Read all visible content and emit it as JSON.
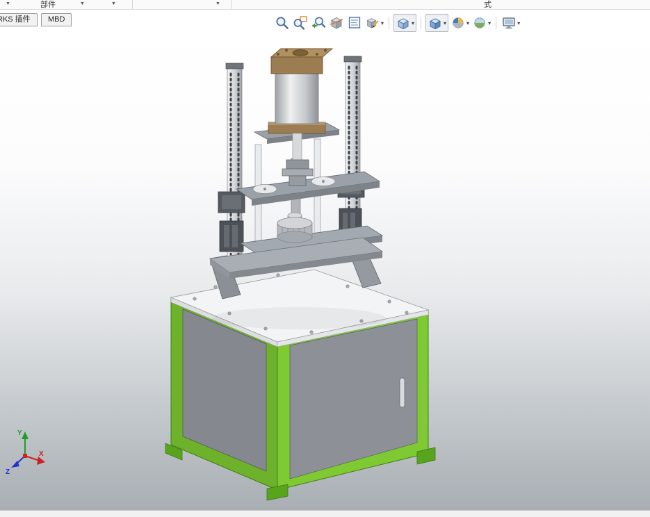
{
  "top_toolbar": {
    "label_left": "部件",
    "label_right": "式",
    "caret_glyph": "▼"
  },
  "tab_bar": {
    "tabs": [
      {
        "label": "RKS 插件"
      },
      {
        "label": "MBD"
      }
    ]
  },
  "headsup_toolbar": {
    "caret_glyph": "▾",
    "icons": [
      {
        "name": "zoom-to-fit",
        "dropdown": false
      },
      {
        "name": "zoom-to-area",
        "dropdown": false
      },
      {
        "name": "previous-view",
        "dropdown": false
      },
      {
        "name": "section-view",
        "dropdown": false
      },
      {
        "name": "annotation-3d-view",
        "dropdown": false
      },
      {
        "name": "dynamic-annotation",
        "dropdown": true
      },
      {
        "name": "view-orientation",
        "dropdown": true
      },
      {
        "name": "display-style",
        "dropdown": true
      },
      {
        "name": "edit-appearance",
        "dropdown": true
      },
      {
        "name": "apply-scene",
        "dropdown": true
      },
      {
        "name": "view-settings",
        "dropdown": true
      }
    ]
  },
  "viewport": {
    "triad": {
      "x_label": "X",
      "y_label": "Y",
      "z_label": "Z"
    }
  },
  "colors": {
    "frame-green": "#6db22a",
    "frame-green-light": "#7fca33",
    "frame-green-dark": "#58a51d",
    "panel-gray": "#8d9197",
    "panel-gray-dark": "#85898f",
    "table-white": "#f3f4f6",
    "axis-x": "#cc2222",
    "axis-y": "#1f9d2c",
    "axis-z": "#2233cc"
  }
}
